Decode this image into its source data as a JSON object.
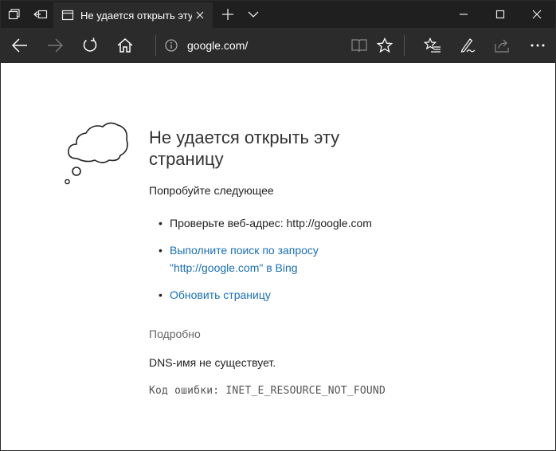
{
  "tab": {
    "title": "Не удается открыть эту"
  },
  "address_bar": {
    "url": "google.com/"
  },
  "error_page": {
    "heading": "Не удается открыть эту страницу",
    "try_text": "Попробуйте следующее",
    "suggestions": {
      "check_address": "Проверьте веб-адрес: http://google.com",
      "search_bing_line1": "Выполните поиск по запросу",
      "search_bing_line2": "\"http://google.com\" в Bing",
      "refresh": "Обновить страницу"
    },
    "details_label": "Подробно",
    "dns_message": "DNS-имя не существует.",
    "error_code": "Код ошибки: INET_E_RESOURCE_NOT_FOUND"
  },
  "icons": {
    "titlebar": [
      "tabs-overview-icon",
      "set-aside-tabs-icon",
      "tab-page-icon",
      "close-tab-icon",
      "new-tab-icon",
      "tab-preview-icon",
      "minimize-icon",
      "maximize-icon",
      "close-window-icon"
    ],
    "navbar": [
      "back-icon",
      "forward-icon",
      "refresh-icon",
      "home-icon",
      "info-icon",
      "reading-view-icon",
      "favorite-star-icon",
      "favorites-hub-icon",
      "web-note-icon",
      "share-icon",
      "more-icon"
    ],
    "content": [
      "thought-bubble-icon"
    ]
  },
  "colors": {
    "titlebar": "#1f1f1f",
    "navbar": "#2b2b2b",
    "active_tab": "#2b2b2b",
    "link": "#1a6fb8"
  }
}
